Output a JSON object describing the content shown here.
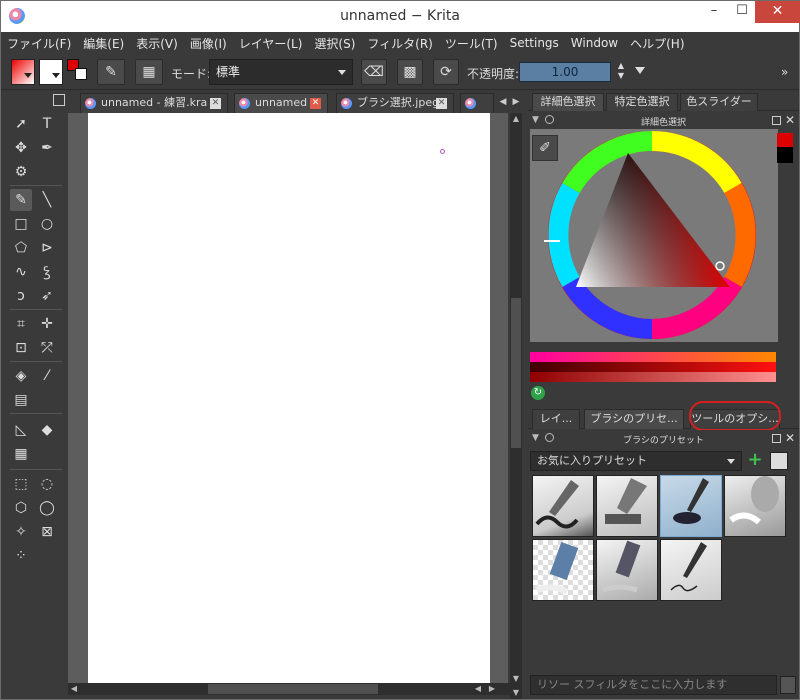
{
  "window": {
    "title": "unnamed − Krita"
  },
  "menubar": [
    "ファイル(F)",
    "編集(E)",
    "表示(V)",
    "画像(I)",
    "レイヤー(L)",
    "選択(S)",
    "フィルタ(R)",
    "ツール(T)",
    "Settings",
    "Window",
    "ヘルプ(H)"
  ],
  "toolbar": {
    "mode_label": "モード:",
    "mode_value": "標準",
    "opacity_label": "不透明度:",
    "opacity_value": "1.00",
    "overflow": "»"
  },
  "documents": [
    {
      "label": "unnamed - 練習.kra",
      "active": false
    },
    {
      "label": "unnamed",
      "active": true
    },
    {
      "label": "ブラシ選択.jpeg",
      "active": false
    }
  ],
  "right_tabs": [
    "詳細色選択",
    "特定色選択",
    "色スライダー"
  ],
  "color_docker": {
    "title": "詳細色選択",
    "fg_color": "#dd0000",
    "bg_color": "#000000"
  },
  "bottom_tabs": [
    "レイ...",
    "ブラシのプリセ...",
    "ツールのオプシ..."
  ],
  "preset_docker": {
    "title": "ブラシのプリセット",
    "tag_value": "お気に入りプリセット",
    "add_icon": "+",
    "filter_placeholder": "リソー スフィルタをここに入力します"
  }
}
